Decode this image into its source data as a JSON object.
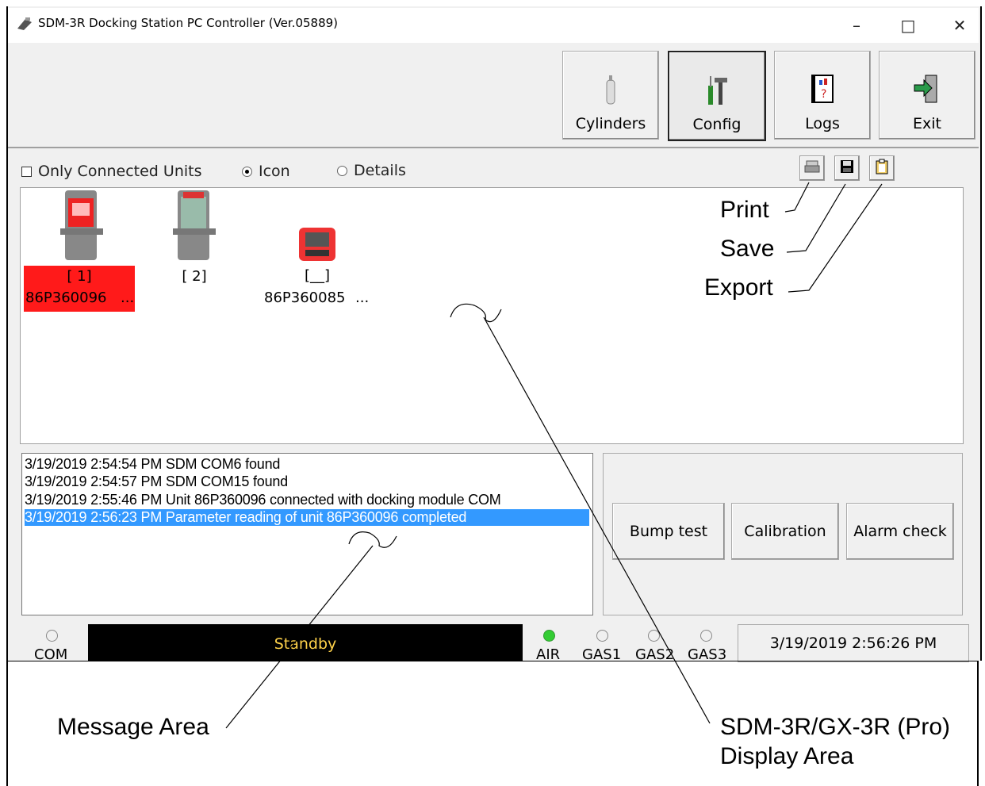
{
  "window": {
    "title": "SDM-3R Docking Station PC Controller (Ver.05889)",
    "minimize": "–",
    "maximize": "□",
    "close": "✕"
  },
  "toolbar": {
    "cylinders": "Cylinders",
    "config": "Config",
    "logs": "Logs",
    "exit": "Exit"
  },
  "view_options": {
    "only_connected": "Only Connected Units",
    "icon": "Icon",
    "details": "Details",
    "selected": "Icon"
  },
  "units": [
    {
      "label": "[ 1]",
      "serial": "86P360096",
      "more": "...",
      "selected": true
    },
    {
      "label": "[ 2]",
      "serial": "",
      "more": "",
      "selected": false
    },
    {
      "label": "[__]",
      "serial": "86P360085",
      "more": "...",
      "selected": false
    }
  ],
  "messages": [
    "3/19/2019 2:54:54 PM SDM COM6 found",
    "3/19/2019 2:54:57 PM SDM COM15 found",
    "3/19/2019 2:55:46 PM Unit 86P360096 connected with docking module COM",
    "3/19/2019 2:56:23 PM Parameter reading of unit 86P360096 completed"
  ],
  "actions": {
    "bump": "Bump test",
    "calibration": "Calibration",
    "alarm": "Alarm check"
  },
  "status": {
    "com": "COM",
    "state": "Standby",
    "air": "AIR",
    "gas1": "GAS1",
    "gas2": "GAS2",
    "gas3": "GAS3",
    "datetime": "3/19/2019 2:56:26 PM"
  },
  "callouts": {
    "print": "Print",
    "save": "Save",
    "export": "Export",
    "message_area": "Message Area",
    "display_line1": "SDM-3R/GX-3R (Pro)",
    "display_line2": "Display Area"
  },
  "colors": {
    "selection_blue": "#3399ff",
    "selected_unit_red": "#ff1a1a",
    "standby_text": "#ffd24a",
    "air_led": "#33cc33"
  }
}
